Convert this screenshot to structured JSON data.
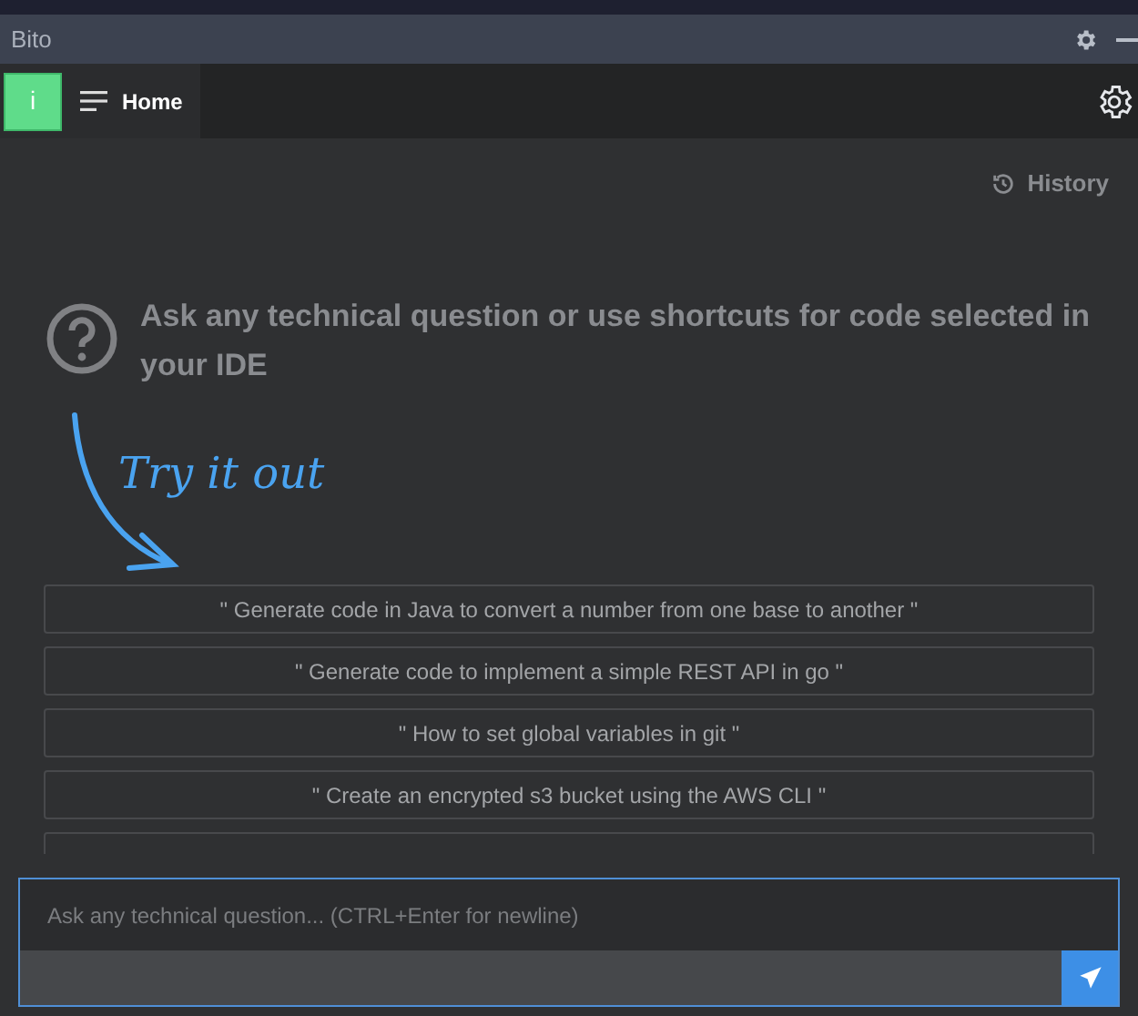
{
  "window": {
    "title": "Bito"
  },
  "tabs": [
    {
      "label": "Home",
      "selected": true
    }
  ],
  "avatar": {
    "letter": "i"
  },
  "history": {
    "label": "History"
  },
  "intro": {
    "text": "Ask any technical question or use shortcuts for code selected in your IDE",
    "hint": "Try it out"
  },
  "suggestions": [
    {
      "label": "\" Generate code in Java to convert a number from one base to another \""
    },
    {
      "label": "\" Generate code to implement a simple REST API in go \""
    },
    {
      "label": "\" How to set global variables in git \""
    },
    {
      "label": "\" Create an encrypted s3 bucket using the AWS CLI \""
    }
  ],
  "input": {
    "placeholder": "Ask any technical question... (CTRL+Enter for newline)"
  }
}
